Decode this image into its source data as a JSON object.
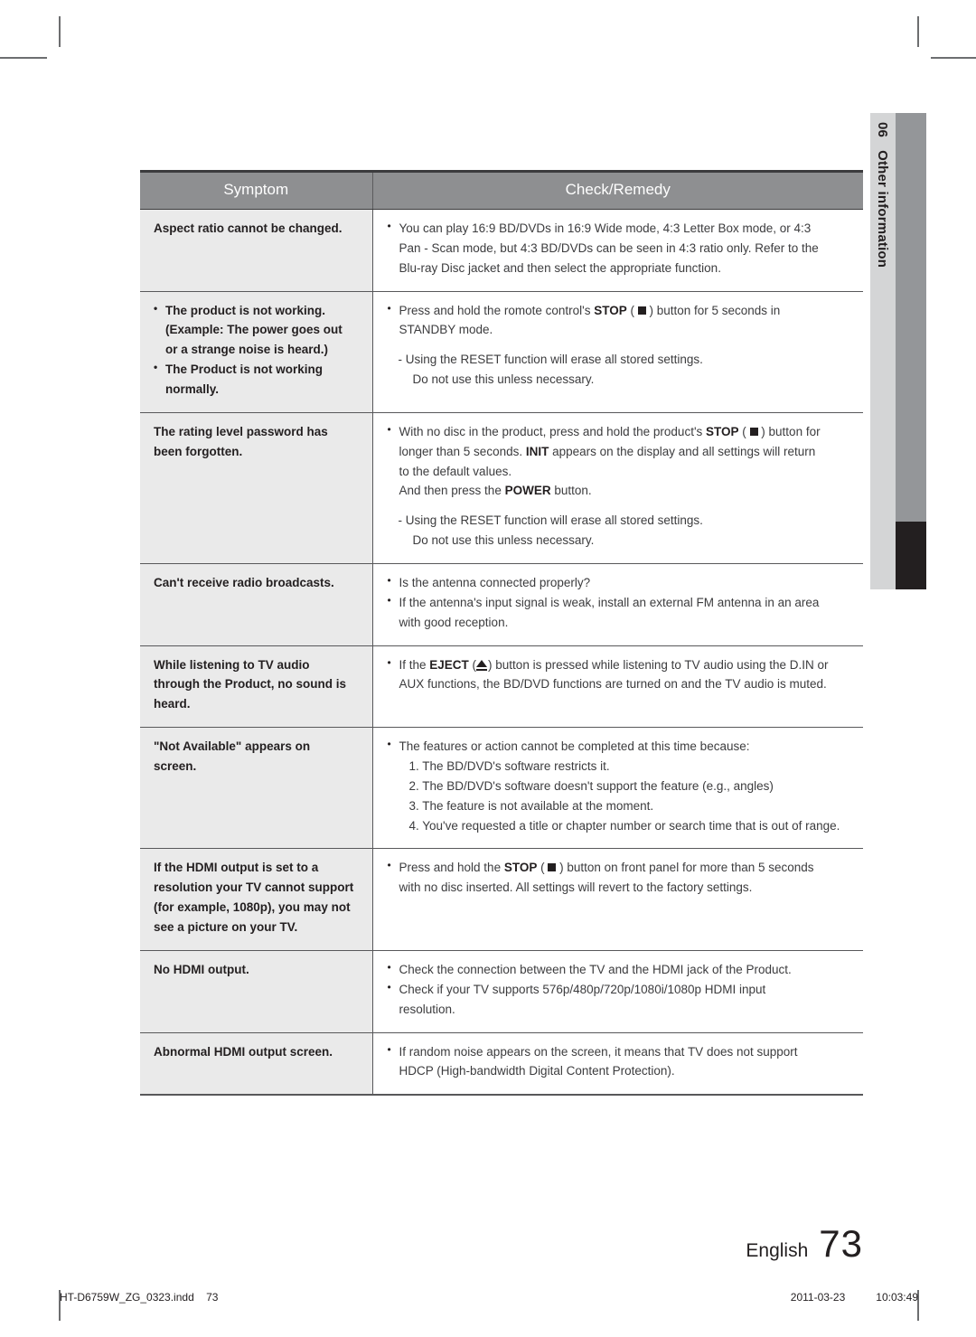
{
  "side_tab": {
    "chapter_number": "06",
    "chapter_title": "Other information"
  },
  "table": {
    "headers": {
      "symptom": "Symptom",
      "remedy": "Check/Remedy"
    },
    "rows": [
      {
        "symptom_lines": [
          "Aspect ratio cannot be changed."
        ],
        "remedy_lines": [
          "You can play 16:9 BD/DVDs in 16:9 Wide mode, 4:3 Letter Box mode, or 4:3",
          "Pan - Scan mode, but 4:3 BD/DVDs can be seen in 4:3 ratio only. Refer to the",
          "Blu-ray Disc jacket and then select the appropriate function."
        ]
      },
      {
        "symptom_lines": [
          "The product is not working.",
          "(Example: The power goes out",
          "or a strange noise is heard.)",
          "The Product is not working",
          "normally."
        ],
        "remedy_lines": [
          "Press and hold the romote control's STOP ( ■ ) button for 5 seconds in",
          "STANDBY mode.",
          "- Using the RESET function will erase all stored settings.",
          "Do not use this unless necessary."
        ]
      },
      {
        "symptom_lines": [
          "The rating level password has",
          "been forgotten."
        ],
        "remedy_lines": [
          "With no disc in the product, press and hold the product's STOP ( ■ ) button for",
          "longer than 5 seconds. INIT appears on the display and all settings will return",
          "to the default values.",
          "And then press the POWER button.",
          "- Using the RESET function will erase all stored settings.",
          "Do not use this unless necessary."
        ]
      },
      {
        "symptom_lines": [
          "Can't receive radio broadcasts."
        ],
        "remedy_lines": [
          "Is the antenna connected properly?",
          "If the antenna's input signal is weak, install an external FM antenna in an area",
          "with good reception."
        ]
      },
      {
        "symptom_lines": [
          "While listening to TV audio",
          "through the Product, no sound is",
          "heard."
        ],
        "remedy_lines": [
          "If the EJECT (▲) button is pressed while listening to TV audio using the D.IN or",
          "AUX functions, the BD/DVD functions are turned on and the TV audio is muted."
        ]
      },
      {
        "symptom_lines": [
          "\"Not Available\" appears on",
          "screen."
        ],
        "remedy_lines": [
          "The features or action cannot be completed at this time because:",
          "1. The BD/DVD's software restricts it.",
          "2. The BD/DVD's software doesn't support the feature (e.g., angles)",
          "3. The feature is not available at the moment.",
          "4. You've requested a title or chapter number or search time that is out of range."
        ]
      },
      {
        "symptom_lines": [
          "If the HDMI output is set to a",
          "resolution your TV cannot support",
          "(for example, 1080p), you may not",
          "see a picture on your TV."
        ],
        "remedy_lines": [
          "Press and hold the STOP ( ■ ) button on front panel for more than 5 seconds",
          "with no disc inserted. All settings will revert to the factory settings."
        ]
      },
      {
        "symptom_lines": [
          "No HDMI output."
        ],
        "remedy_lines": [
          "Check the connection between the TV and the HDMI jack of the Product.",
          "Check if your TV supports 576p/480p/720p/1080i/1080p HDMI input",
          "resolution."
        ]
      },
      {
        "symptom_lines": [
          "Abnormal HDMI output screen."
        ],
        "remedy_lines": [
          "If random noise appears on the screen, it means that TV does not support",
          "HDCP (High-bandwidth Digital Content Protection)."
        ]
      }
    ]
  },
  "footer": {
    "language": "English",
    "page_number": "73",
    "file_name": "HT-D6759W_ZG_0323.indd",
    "file_page": "73",
    "print_date": "2011-03-23",
    "print_time": "10:03:49"
  },
  "colors": {
    "header_bg": "#8e8f91",
    "symptom_bg": "#eaeaea",
    "rule": "#58585a",
    "tab_light": "#d4d5d6",
    "tab_bar": "#949699",
    "tab_bar_dark": "#231f20",
    "text": "#231f20"
  }
}
